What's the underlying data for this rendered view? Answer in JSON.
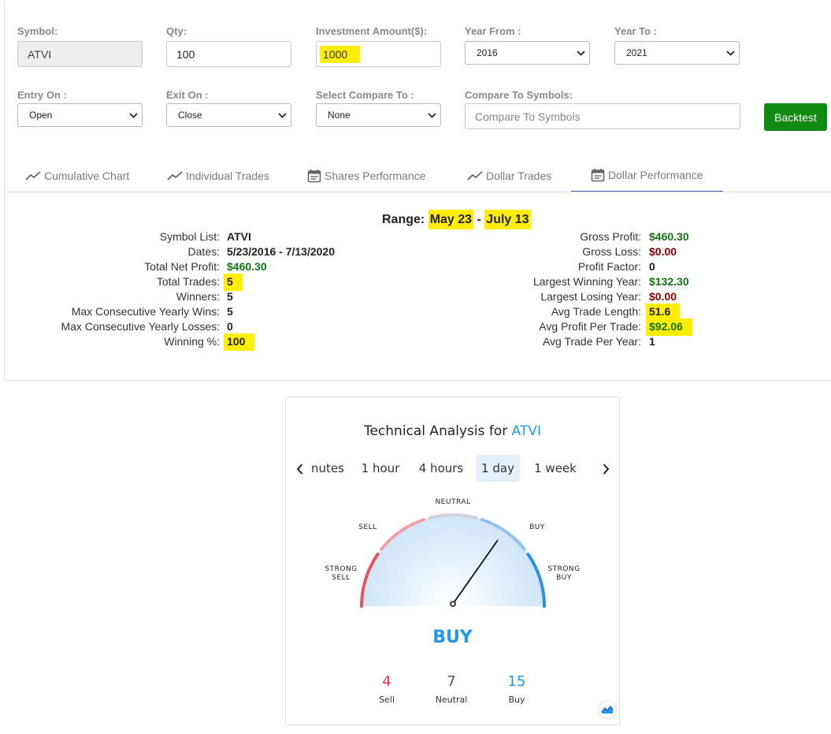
{
  "form": {
    "symbol": {
      "label": "Symbol:",
      "value": "ATVI"
    },
    "qty": {
      "label": "Qty:",
      "value": "100"
    },
    "investment": {
      "label": "Investment Amount($):",
      "value": "1000"
    },
    "year_from": {
      "label": "Year From :",
      "value": "2016"
    },
    "year_to": {
      "label": "Year To :",
      "value": "2021"
    },
    "entry_on": {
      "label": "Entry On :",
      "value": "Open"
    },
    "exit_on": {
      "label": "Exit On :",
      "value": "Close"
    },
    "compare_select": {
      "label": "Select Compare To :",
      "value": "None"
    },
    "compare_symbols": {
      "label": "Compare To Symbols:",
      "placeholder": "Compare To Symbols"
    },
    "backtest_label": "Backtest"
  },
  "tabs": [
    {
      "label": "Cumulative Chart",
      "icon": "trend-line-icon"
    },
    {
      "label": "Individual Trades",
      "icon": "trend-line-icon"
    },
    {
      "label": "Shares Performance",
      "icon": "calendar-icon"
    },
    {
      "label": "Dollar Trades",
      "icon": "trend-line-icon"
    },
    {
      "label": "Dollar Performance",
      "icon": "calendar-icon",
      "active": true
    }
  ],
  "summary": {
    "range_label": "Range:",
    "range_start": "May 23",
    "range_sep": "-",
    "range_end": "July 13",
    "left": [
      {
        "label": "Symbol List:",
        "value": "ATVI"
      },
      {
        "label": "Dates:",
        "value": "5/23/2016 - 7/13/2020"
      },
      {
        "label": "Total Net Profit:",
        "value": "$460.30"
      },
      {
        "label": "Total Trades:",
        "value": "5"
      },
      {
        "label": "Winners:",
        "value": "5"
      },
      {
        "label": "Max Consecutive Yearly Wins:",
        "value": "5"
      },
      {
        "label": "Max Consecutive Yearly Losses:",
        "value": "0"
      },
      {
        "label": "Winning %:",
        "value": "100"
      }
    ],
    "right": [
      {
        "label": "Gross Profit:",
        "value": "$460.30"
      },
      {
        "label": "Gross Loss:",
        "value": "$0.00"
      },
      {
        "label": "Profit Factor:",
        "value": "0"
      },
      {
        "label": "Largest Winning Year:",
        "value": "$132.30"
      },
      {
        "label": "Largest Losing Year:",
        "value": "$0.00"
      },
      {
        "label": "Avg Trade Length:",
        "value": "51.6"
      },
      {
        "label": "Avg Profit Per Trade:",
        "value": "$92.06"
      },
      {
        "label": "Avg Trade Per Year:",
        "value": "1"
      }
    ]
  },
  "technical": {
    "title": "Technical Analysis for",
    "symbol": "ATVI",
    "periods": [
      "nutes",
      "1 hour",
      "4 hours",
      "1 day",
      "1 week"
    ],
    "active_period": "1 day",
    "gauge_labels": {
      "strong_sell": "STRONG\nSELL",
      "sell": "SELL",
      "neutral": "NEUTRAL",
      "buy": "BUY",
      "strong_buy": "STRONG\nBUY"
    },
    "verdict": "BUY",
    "counts": [
      {
        "label": "Sell",
        "value": "4",
        "color": "#f23645"
      },
      {
        "label": "Neutral",
        "value": "7",
        "color": "#555555"
      },
      {
        "label": "Buy",
        "value": "15",
        "color": "#2196f3"
      }
    ]
  },
  "colors": {
    "backtest": "#118a11",
    "profit": "#117511",
    "loss": "#8b0000",
    "accent": "#2196f3",
    "highlight": "#ffee00"
  }
}
